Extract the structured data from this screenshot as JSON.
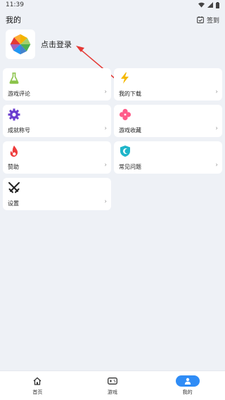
{
  "status": {
    "time": "11:39"
  },
  "header": {
    "title": "我的",
    "checkin_label": "签到"
  },
  "profile": {
    "login_label": "点击登录"
  },
  "menu": [
    {
      "label": "游戏评论",
      "icon": "flask-icon",
      "color": "#8bc34a"
    },
    {
      "label": "我的下载",
      "icon": "lightning-icon",
      "color": "#f5b800"
    },
    {
      "label": "成就称号",
      "icon": "gear-badge-icon",
      "color": "#6a3ccf"
    },
    {
      "label": "游戏收藏",
      "icon": "clover-heart-icon",
      "color": "#ff5c8a"
    },
    {
      "label": "赞助",
      "icon": "flame-icon",
      "color": "#ee3b3b"
    },
    {
      "label": "常见问题",
      "icon": "shield-icon",
      "color": "#1fb5c9"
    },
    {
      "label": "设置",
      "icon": "crossed-swords-icon",
      "color": "#222222"
    }
  ],
  "nav": [
    {
      "label": "首页",
      "icon": "home-icon"
    },
    {
      "label": "游戏",
      "icon": "gamepad-icon"
    },
    {
      "label": "我的",
      "icon": "person-icon",
      "active": true
    }
  ],
  "colors": {
    "accent": "#2f8cf6",
    "background": "#eef1f6",
    "annotation": "#e53935"
  }
}
